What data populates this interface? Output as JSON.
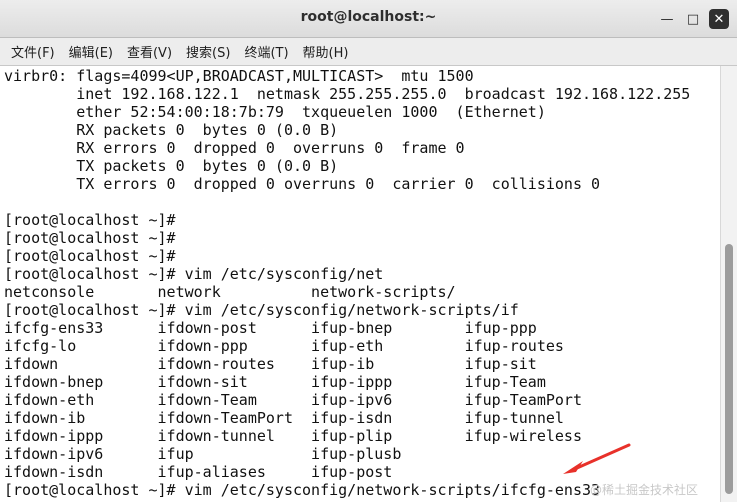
{
  "window": {
    "title": "root@localhost:~",
    "minimize_glyph": "—",
    "maximize_glyph": "□",
    "close_glyph": "✕"
  },
  "menu": [
    "文件(F)",
    "编辑(E)",
    "查看(V)",
    "搜索(S)",
    "终端(T)",
    "帮助(H)"
  ],
  "terminal_lines": [
    "virbr0: flags=4099<UP,BROADCAST,MULTICAST>  mtu 1500",
    "        inet 192.168.122.1  netmask 255.255.255.0  broadcast 192.168.122.255",
    "        ether 52:54:00:18:7b:79  txqueuelen 1000  (Ethernet)",
    "        RX packets 0  bytes 0 (0.0 B)",
    "        RX errors 0  dropped 0  overruns 0  frame 0",
    "        TX packets 0  bytes 0 (0.0 B)",
    "        TX errors 0  dropped 0 overruns 0  carrier 0  collisions 0",
    "",
    "[root@localhost ~]#",
    "[root@localhost ~]#",
    "[root@localhost ~]#",
    "[root@localhost ~]# vim /etc/sysconfig/net",
    "netconsole       network          network-scripts/",
    "[root@localhost ~]# vim /etc/sysconfig/network-scripts/if",
    "ifcfg-ens33      ifdown-post      ifup-bnep        ifup-ppp",
    "ifcfg-lo         ifdown-ppp       ifup-eth         ifup-routes",
    "ifdown           ifdown-routes    ifup-ib          ifup-sit",
    "ifdown-bnep      ifdown-sit       ifup-ippp        ifup-Team",
    "ifdown-eth       ifdown-Team      ifup-ipv6        ifup-TeamPort",
    "ifdown-ib        ifdown-TeamPort  ifup-isdn        ifup-tunnel",
    "ifdown-ippp      ifdown-tunnel    ifup-plip        ifup-wireless",
    "ifdown-ipv6      ifup             ifup-plusb",
    "ifdown-isdn      ifup-aliases     ifup-post",
    "[root@localhost ~]# vim /etc/sysconfig/network-scripts/ifcfg-ens33"
  ],
  "annotation": {
    "arrow_color": "#e8312a"
  },
  "watermark": "@稀土掘金技术社区"
}
